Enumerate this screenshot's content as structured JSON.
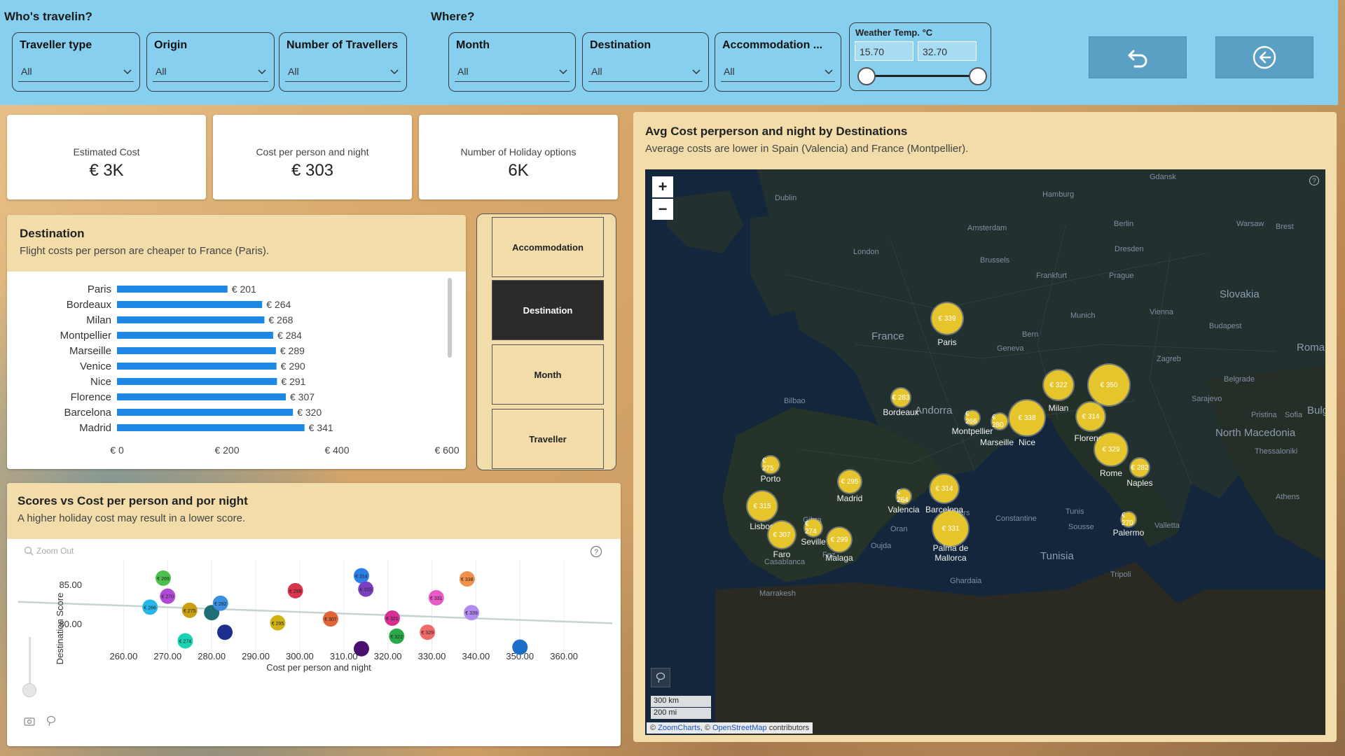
{
  "filters": {
    "who_label": "Who's travelin?",
    "where_label": "Where?",
    "slicers": [
      {
        "title": "Traveller type",
        "value": "All"
      },
      {
        "title": "Origin",
        "value": "All"
      },
      {
        "title": "Number of Travellers",
        "value": "All"
      },
      {
        "title": "Month",
        "value": "All"
      },
      {
        "title": "Destination",
        "value": "All"
      },
      {
        "title": "Accommodation ...",
        "value": "All"
      }
    ],
    "weather": {
      "title": "Weather Temp. °C",
      "min": "15.70",
      "max": "32.70"
    }
  },
  "nav": {
    "undo_icon": "undo-arrow-icon",
    "back_icon": "back-circle-icon"
  },
  "kpis": [
    {
      "label": "Estimated Cost",
      "value": "€ 3K"
    },
    {
      "label": "Cost per person and night",
      "value": "€ 303"
    },
    {
      "label": "Number of Holiday options",
      "value": "6K"
    }
  ],
  "destination_panel": {
    "title": "Destination",
    "subtitle": "Flight costs per person are cheaper to France (Paris)."
  },
  "toggles": [
    "Accommodation",
    "Destination",
    "Month",
    "Traveller"
  ],
  "active_toggle": "Destination",
  "scatter_panel": {
    "title": "Scores vs Cost per person and por night",
    "subtitle": "A higher holiday cost may result in a lower score.",
    "zoom_out": "Zoom Out"
  },
  "map_panel": {
    "title": "Avg Cost perperson and night by Destinations",
    "subtitle": "Average costs are lower in Spain (Valencia) and France (Montpellier).",
    "zoom_in": "+",
    "zoom_out": "−",
    "scale_km": "300 km",
    "scale_mi": "200 mi",
    "attribution_prefix": "© ",
    "attribution_zc": "ZoomCharts",
    "attribution_mid": ", © ",
    "attribution_osm": "OpenStreetMap",
    "attribution_suffix": " contributors",
    "countries": [
      "France",
      "Andorra",
      "Slovakia",
      "Tunisia",
      "North Macedonia",
      "Romani",
      "Bulg"
    ],
    "place_labels": [
      "Dublin",
      "London",
      "Amsterdam",
      "Hamburg",
      "Berlin",
      "Brussels",
      "Frankfurt",
      "Prague",
      "Munich",
      "Vienna",
      "Budapest",
      "Zagreb",
      "Belgrade",
      "Sarajevo",
      "Pristina",
      "Sofia",
      "Thessaloniki",
      "Athens",
      "Bern",
      "Geneva",
      "Bilbao",
      "Algiers",
      "Constantine",
      "Tunis",
      "Sousse",
      "Valletta",
      "Tripoli",
      "Oran",
      "Oujda",
      "Fez",
      "Casablanca",
      "Marrakesh",
      "Ghardaia",
      "Gdansk",
      "Warsaw",
      "Brest",
      "Dresden",
      "Rome",
      "Gibra"
    ],
    "destinations": [
      {
        "city": "Paris",
        "cost": "€ 339"
      },
      {
        "city": "Bordeaux",
        "cost": "€ 283"
      },
      {
        "city": "Montpellier",
        "cost": "€ 266"
      },
      {
        "city": "Marseille",
        "cost": "€ 280"
      },
      {
        "city": "Nice",
        "cost": "€ 338"
      },
      {
        "city": "Milan",
        "cost": "€ 322"
      },
      {
        "city": "Venice",
        "cost": "€ 350"
      },
      {
        "city": "Florence",
        "cost": "€ 314"
      },
      {
        "city": "Rome",
        "cost": "€ 329"
      },
      {
        "city": "Naples",
        "cost": "€ 282"
      },
      {
        "city": "Palermo",
        "cost": "€ 270"
      },
      {
        "city": "Porto",
        "cost": "€ 275"
      },
      {
        "city": "Lisbon",
        "cost": "€ 315"
      },
      {
        "city": "Faro",
        "cost": "€ 307"
      },
      {
        "city": "Seville",
        "cost": "€ 274"
      },
      {
        "city": "Malaga",
        "cost": "€ 299"
      },
      {
        "city": "Madrid",
        "cost": "€ 295"
      },
      {
        "city": "Valencia",
        "cost": "€ 264"
      },
      {
        "city": "Barcelona",
        "cost": "€ 314"
      },
      {
        "city": "Palma de Mallorca",
        "cost": "€ 331"
      }
    ]
  },
  "chart_data": [
    {
      "type": "bar",
      "orientation": "horizontal",
      "categories": [
        "Paris",
        "Bordeaux",
        "Milan",
        "Montpellier",
        "Marseille",
        "Venice",
        "Nice",
        "Florence",
        "Barcelona",
        "Madrid"
      ],
      "values": [
        201,
        264,
        268,
        284,
        289,
        290,
        291,
        307,
        320,
        341
      ],
      "value_labels": [
        "€ 201",
        "€ 264",
        "€ 268",
        "€ 284",
        "€ 289",
        "€ 290",
        "€ 291",
        "€ 307",
        "€ 320",
        "€ 341"
      ],
      "xticks": [
        "€ 0",
        "€ 200",
        "€ 400",
        "€ 600"
      ],
      "xlim": [
        0,
        600
      ],
      "color": "#1e88e5"
    },
    {
      "type": "scatter",
      "xlabel": "Cost per person and night",
      "ylabel": "Destination Score",
      "xlim": [
        255,
        370
      ],
      "ylim": [
        77.5,
        87.5
      ],
      "xticks": [
        "260.00",
        "270.00",
        "280.00",
        "290.00",
        "300.00",
        "310.00",
        "320.00",
        "330.00",
        "340.00",
        "350.00",
        "360.00"
      ],
      "yticks": [
        "80.00",
        "85.00"
      ],
      "trendline": {
        "x": [
          255,
          370
        ],
        "y": [
          82.7,
          80.5
        ],
        "color": "#c5d3d0"
      },
      "points": [
        {
          "x": 269,
          "y": 85.9,
          "label": "€ 269",
          "color": "#4cc04c"
        },
        {
          "x": 270,
          "y": 83.6,
          "label": "€ 270",
          "color": "#b04bd6"
        },
        {
          "x": 266,
          "y": 82.2,
          "label": "€ 266",
          "color": "#27b8ea"
        },
        {
          "x": 275,
          "y": 81.8,
          "label": "€ 275",
          "color": "#c9a012"
        },
        {
          "x": 280,
          "y": 81.5,
          "label": "",
          "color": "#1e6e74"
        },
        {
          "x": 282,
          "y": 82.7,
          "label": "€ 282",
          "color": "#3a8fe0"
        },
        {
          "x": 274,
          "y": 77.9,
          "label": "€ 274",
          "color": "#19d3b3"
        },
        {
          "x": 283,
          "y": 79.0,
          "label": "",
          "color": "#1c2f8c"
        },
        {
          "x": 295,
          "y": 80.2,
          "label": "€ 295",
          "color": "#d1b214"
        },
        {
          "x": 299,
          "y": 84.3,
          "label": "€ 299",
          "color": "#d9334d"
        },
        {
          "x": 307,
          "y": 80.7,
          "label": "€ 307",
          "color": "#e0663a"
        },
        {
          "x": 314,
          "y": 86.2,
          "label": "€ 314",
          "color": "#2c7fe6"
        },
        {
          "x": 315,
          "y": 84.5,
          "label": "€ 315",
          "color": "#7b3fc0"
        },
        {
          "x": 314,
          "y": 76.9,
          "label": "",
          "color": "#4a0e70"
        },
        {
          "x": 321,
          "y": 80.8,
          "label": "€ 321",
          "color": "#d62f94"
        },
        {
          "x": 322,
          "y": 78.5,
          "label": "€ 322",
          "color": "#2aa84a"
        },
        {
          "x": 329,
          "y": 79.0,
          "label": "€ 329",
          "color": "#f06a6a"
        },
        {
          "x": 331,
          "y": 83.4,
          "label": "€ 331",
          "color": "#e85ac6"
        },
        {
          "x": 338,
          "y": 85.8,
          "label": "€ 338",
          "color": "#f0904a"
        },
        {
          "x": 339,
          "y": 81.5,
          "label": "€ 339",
          "color": "#b08cf0"
        },
        {
          "x": 350,
          "y": 77.1,
          "label": "",
          "color": "#1a6fc8"
        }
      ]
    }
  ]
}
